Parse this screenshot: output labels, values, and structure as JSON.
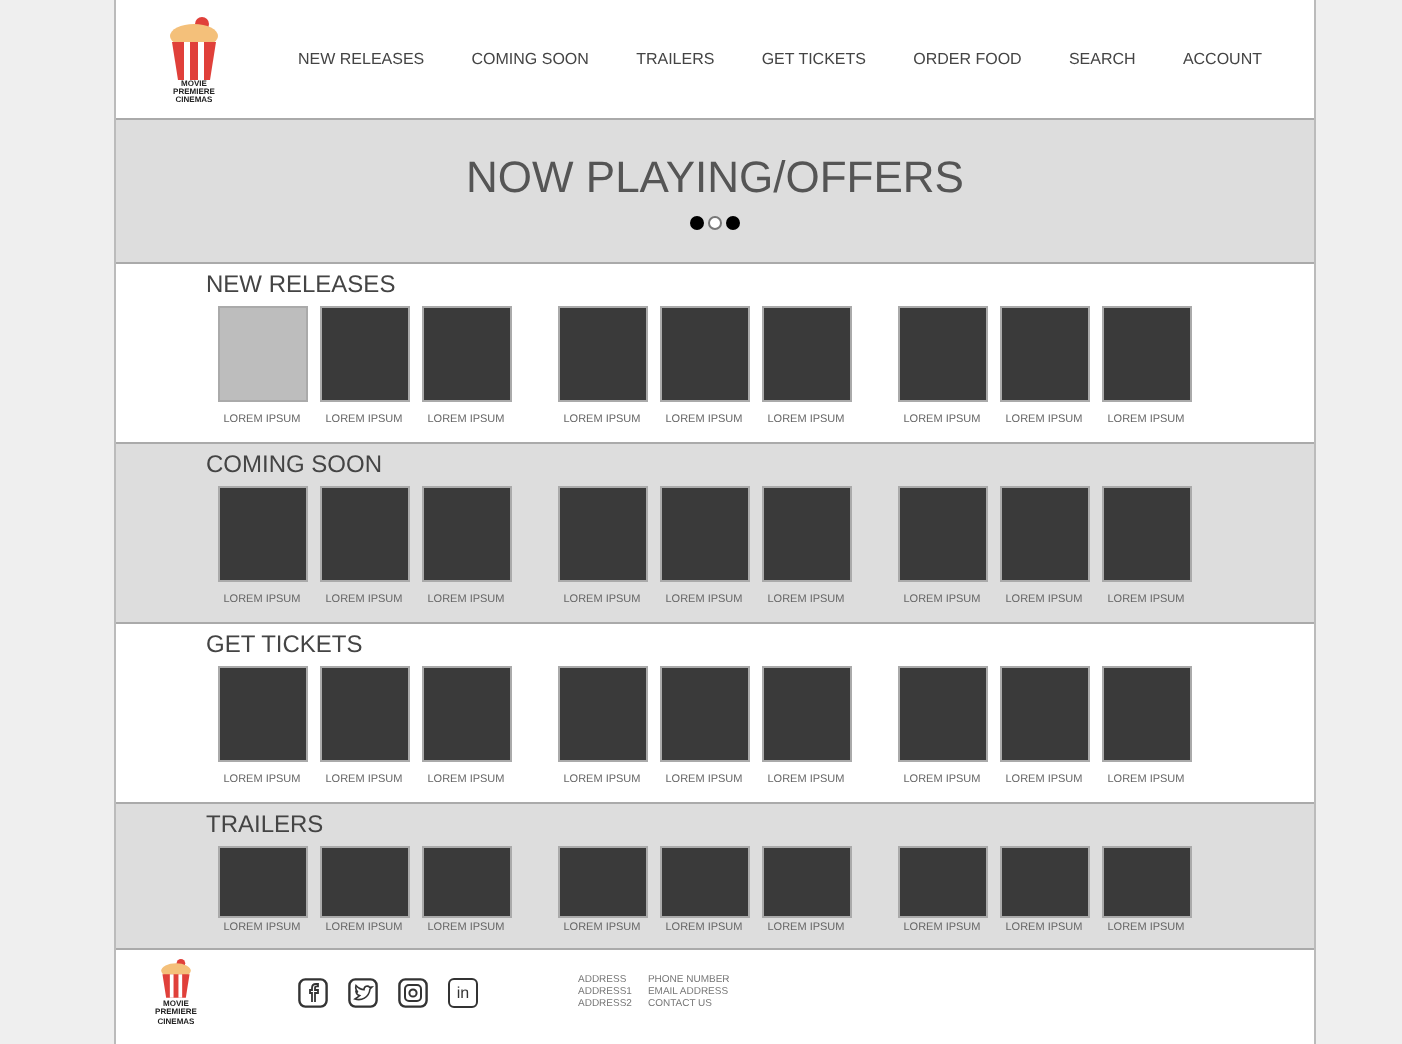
{
  "logo": {
    "text": "MOVIE PREMIERE CINEMAS"
  },
  "nav": [
    {
      "label": "NEW RELEASES"
    },
    {
      "label": "COMING SOON"
    },
    {
      "label": "TRAILERS"
    },
    {
      "label": "GET TICKETS"
    },
    {
      "label": "ORDER FOOD"
    },
    {
      "label": "SEARCH"
    },
    {
      "label": "ACCOUNT"
    }
  ],
  "hero": {
    "title": "NOW PLAYING/OFFERS",
    "dots": [
      {
        "filled": true
      },
      {
        "filled": false
      },
      {
        "filled": true
      }
    ]
  },
  "sections": [
    {
      "title": "NEW RELEASES",
      "shaded": false,
      "groups": [
        [
          {
            "label": "LOREM IPSUM",
            "selected": true
          },
          {
            "label": "LOREM IPSUM",
            "selected": false
          },
          {
            "label": "LOREM IPSUM",
            "selected": false
          }
        ],
        [
          {
            "label": "LOREM IPSUM",
            "selected": false
          },
          {
            "label": "LOREM IPSUM",
            "selected": false
          },
          {
            "label": "LOREM IPSUM",
            "selected": false
          }
        ],
        [
          {
            "label": "LOREM IPSUM",
            "selected": false
          },
          {
            "label": "LOREM IPSUM",
            "selected": false
          },
          {
            "label": "LOREM IPSUM",
            "selected": false
          }
        ]
      ]
    },
    {
      "title": "COMING SOON",
      "shaded": true,
      "groups": [
        [
          {
            "label": "LOREM IPSUM",
            "selected": false
          },
          {
            "label": "LOREM IPSUM",
            "selected": false
          },
          {
            "label": "LOREM IPSUM",
            "selected": false
          }
        ],
        [
          {
            "label": "LOREM IPSUM",
            "selected": false
          },
          {
            "label": "LOREM IPSUM",
            "selected": false
          },
          {
            "label": "LOREM IPSUM",
            "selected": false
          }
        ],
        [
          {
            "label": "LOREM IPSUM",
            "selected": false
          },
          {
            "label": "LOREM IPSUM",
            "selected": false
          },
          {
            "label": "LOREM IPSUM",
            "selected": false
          }
        ]
      ]
    },
    {
      "title": "GET TICKETS",
      "shaded": false,
      "groups": [
        [
          {
            "label": "LOREM IPSUM",
            "selected": false
          },
          {
            "label": "LOREM IPSUM",
            "selected": false
          },
          {
            "label": "LOREM IPSUM",
            "selected": false
          }
        ],
        [
          {
            "label": "LOREM IPSUM",
            "selected": false
          },
          {
            "label": "LOREM IPSUM",
            "selected": false
          },
          {
            "label": "LOREM IPSUM",
            "selected": false
          }
        ],
        [
          {
            "label": "LOREM IPSUM",
            "selected": false
          },
          {
            "label": "LOREM IPSUM",
            "selected": false
          },
          {
            "label": "LOREM IPSUM",
            "selected": false
          }
        ]
      ]
    },
    {
      "title": "TRAILERS",
      "shaded": true,
      "groups": [
        [
          {
            "label": "LOREM IPSUM",
            "selected": false
          },
          {
            "label": "LOREM IPSUM",
            "selected": false
          },
          {
            "label": "LOREM IPSUM",
            "selected": false
          }
        ],
        [
          {
            "label": "LOREM IPSUM",
            "selected": false
          },
          {
            "label": "LOREM IPSUM",
            "selected": false
          },
          {
            "label": "LOREM IPSUM",
            "selected": false
          }
        ],
        [
          {
            "label": "LOREM IPSUM",
            "selected": false
          },
          {
            "label": "LOREM IPSUM",
            "selected": false
          },
          {
            "label": "LOREM IPSUM",
            "selected": false
          }
        ]
      ]
    }
  ],
  "footer": {
    "logo_text": "MOVIE PREMIERE CINEMAS",
    "linkedin_label": "in",
    "address": [
      "ADDRESS",
      "ADDRESS1",
      "ADDRESS2"
    ],
    "contact": [
      "PHONE NUMBER",
      "EMAIL ADDRESS",
      "CONTACT US"
    ]
  }
}
